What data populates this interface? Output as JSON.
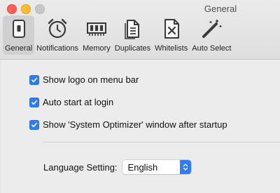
{
  "window": {
    "title": "General",
    "controls": {
      "close": "close",
      "minimize": "minimize",
      "zoom": "zoom"
    }
  },
  "toolbar": {
    "items": [
      {
        "label": "General",
        "icon": "switch-icon",
        "selected": true
      },
      {
        "label": "Notifications",
        "icon": "alarm-clock-icon",
        "selected": false
      },
      {
        "label": "Memory",
        "icon": "memory-chip-icon",
        "selected": false
      },
      {
        "label": "Duplicates",
        "icon": "duplicate-document-icon",
        "selected": false
      },
      {
        "label": "Whitelists",
        "icon": "excluded-document-icon",
        "selected": false
      },
      {
        "label": "Auto Select",
        "icon": "magic-wand-icon",
        "selected": false
      }
    ]
  },
  "settings": {
    "show_logo": {
      "label": "Show logo on menu bar",
      "checked": true
    },
    "auto_start": {
      "label": "Auto start at login",
      "checked": true
    },
    "show_window": {
      "label": "Show 'System Optimizer' window after startup",
      "checked": true
    }
  },
  "language": {
    "label": "Language Setting:",
    "selected": "English"
  },
  "colors": {
    "accent": "#2f7cf6",
    "close": "#ff5f57",
    "minimize": "#febc2e",
    "zoom_inactive": "#c7c7c7"
  }
}
